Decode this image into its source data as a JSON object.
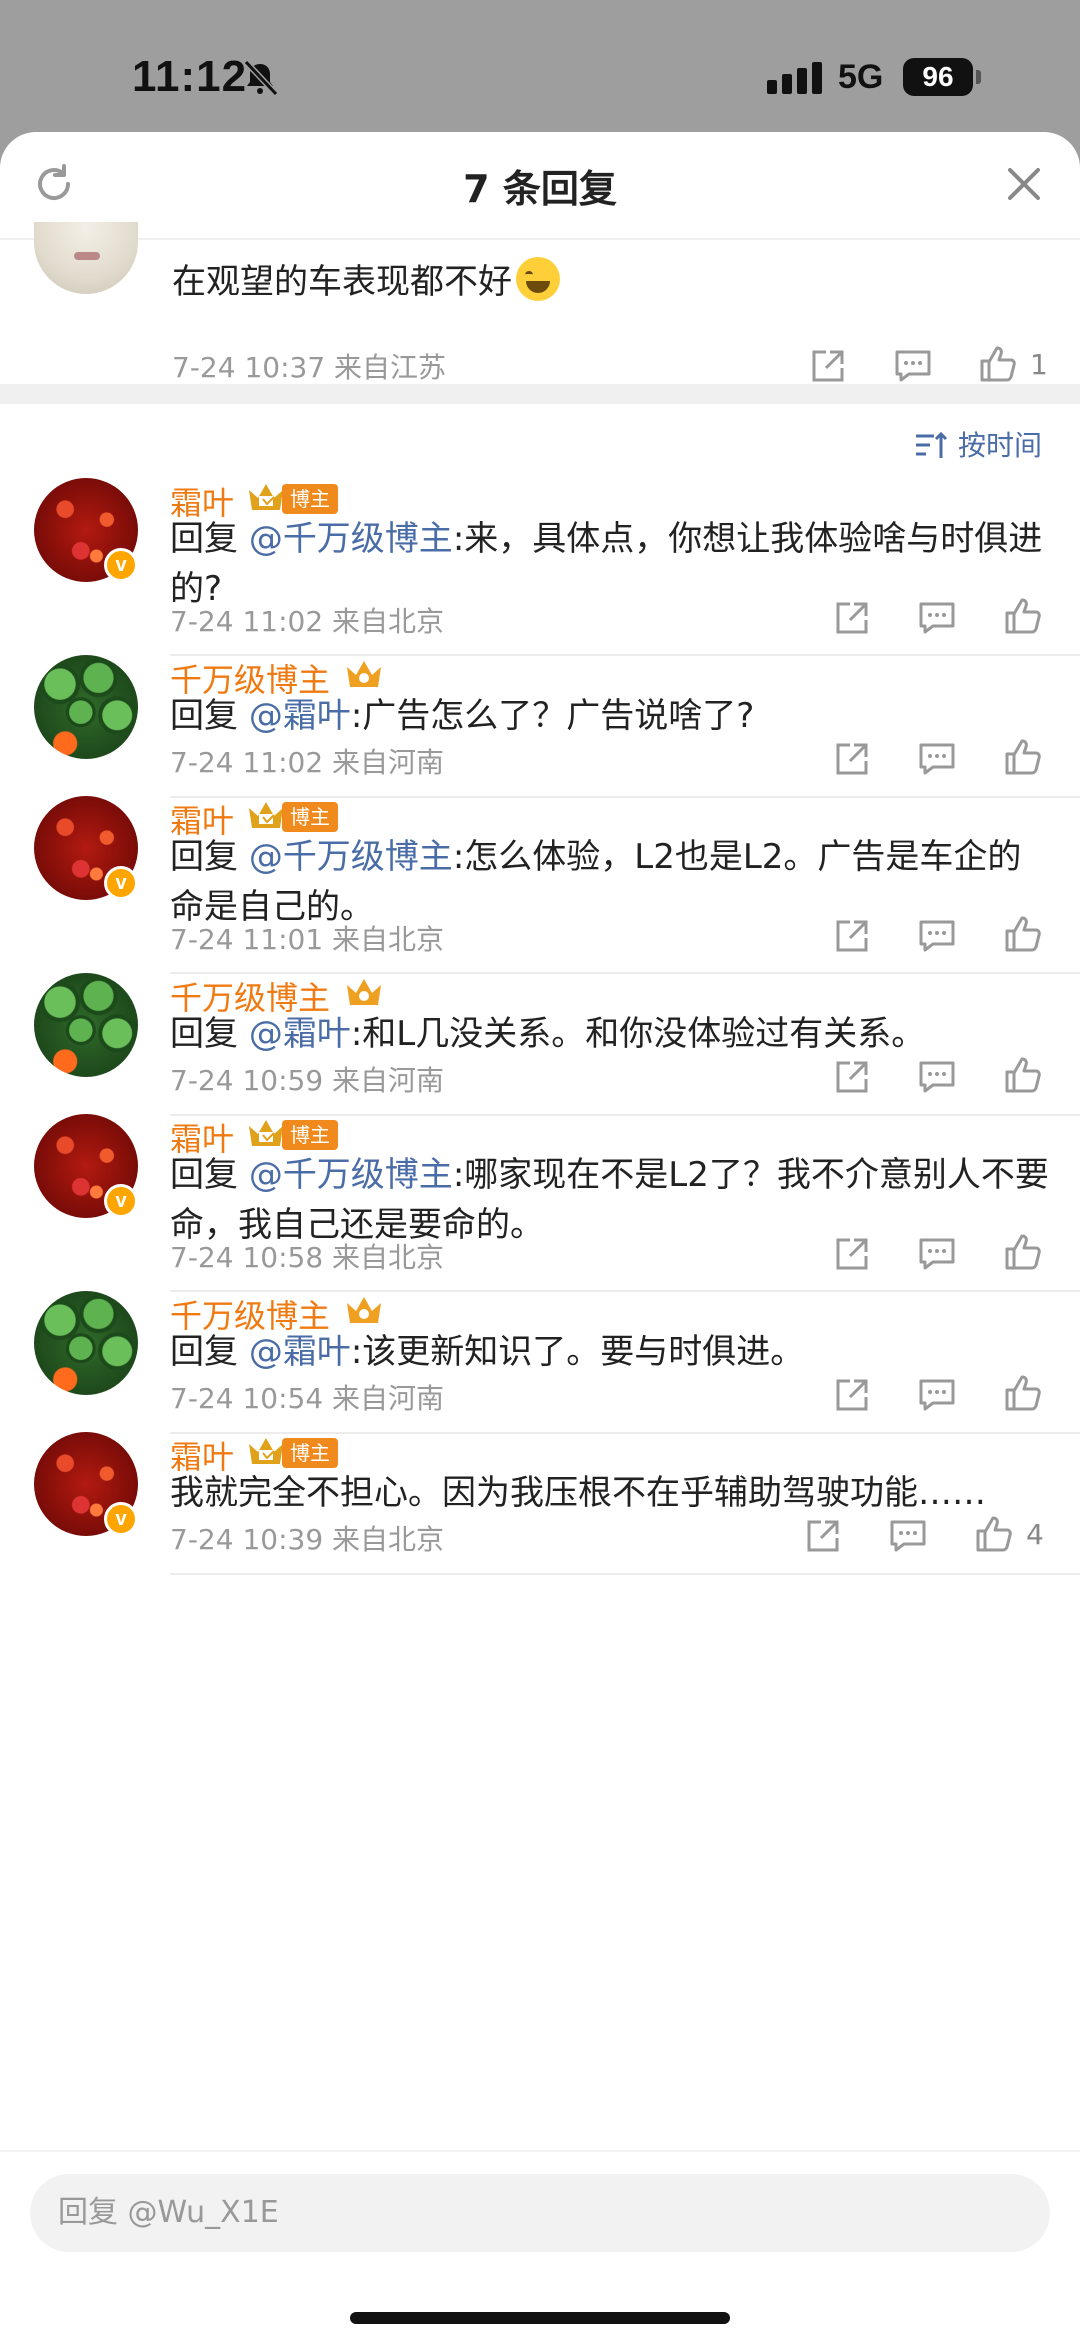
{
  "status_bar": {
    "time": "11:12",
    "network": "5G",
    "battery": "96"
  },
  "header": {
    "title": "7 条回复"
  },
  "original_comment": {
    "text": "在观望的车表现都不好",
    "time": "7-24 10:37",
    "location": "来自江苏",
    "like_count": "1"
  },
  "sort": {
    "label": "按时间"
  },
  "replies": [
    {
      "name": "霜叶",
      "tag": "博主",
      "prefix": "回复",
      "mention": "@千万级博主",
      "text": ":来，具体点，你想让我体验啥与时俱进的?",
      "time": "7-24 11:02",
      "location": "来自北京"
    },
    {
      "name": "千万级博主",
      "tag": "",
      "prefix": "回复",
      "mention": "@霜叶",
      "text": ":广告怎么了？广告说啥了?",
      "time": "7-24 11:02",
      "location": "来自河南"
    },
    {
      "name": "霜叶",
      "tag": "博主",
      "prefix": "回复",
      "mention": "@千万级博主",
      "text": ":怎么体验，L2也是L2。广告是车企的命是自己的。",
      "time": "7-24 11:01",
      "location": "来自北京"
    },
    {
      "name": "千万级博主",
      "tag": "",
      "prefix": "回复",
      "mention": "@霜叶",
      "text": ":和L几没关系。和你没体验过有关系。",
      "time": "7-24 10:59",
      "location": "来自河南"
    },
    {
      "name": "霜叶",
      "tag": "博主",
      "prefix": "回复",
      "mention": "@千万级博主",
      "text": ":哪家现在不是L2了？我不介意别人不要命，我自己还是要命的。",
      "time": "7-24 10:58",
      "location": "来自北京"
    },
    {
      "name": "千万级博主",
      "tag": "",
      "prefix": "回复",
      "mention": "@霜叶",
      "text": ":该更新知识了。要与时俱进。",
      "time": "7-24 10:54",
      "location": "来自河南"
    },
    {
      "name": "霜叶",
      "tag": "博主",
      "prefix": "",
      "mention": "",
      "text": "我就完全不担心。因为我压根不在乎辅助驾驶功能……",
      "time": "7-24 10:39",
      "location": "来自北京",
      "like_count": "4"
    }
  ],
  "input": {
    "placeholder": "回复 @Wu_X1E"
  },
  "icons": {
    "refresh": "refresh-icon",
    "close": "close-icon",
    "share": "share-icon",
    "comment": "comment-icon",
    "like": "thumbs-up-icon",
    "crown": "crown-icon",
    "verified": "verified-v-icon",
    "sort": "sort-icon",
    "mute": "bell-slash-icon"
  },
  "colors": {
    "name": "#f07a12",
    "mention": "#4a6da7",
    "meta": "#999999",
    "tag": "#f08a1c"
  }
}
